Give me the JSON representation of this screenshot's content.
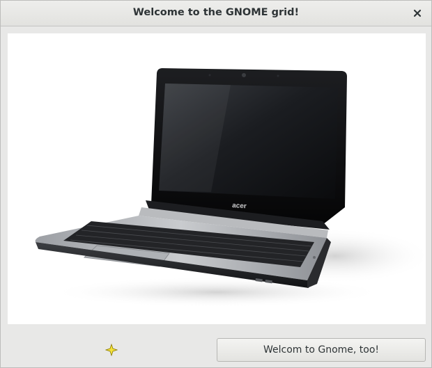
{
  "window": {
    "title": "Welcome to the GNOME grid!",
    "close_icon": "close-icon"
  },
  "image": {
    "description_icon": "laptop-image",
    "brand_mark": "acer"
  },
  "grid": {
    "sparkle_icon": "sparkle-icon",
    "button_label": "Welcom to Gnome, too!"
  },
  "colors": {
    "background": "#e8e8e7",
    "text": "#2e3436",
    "sparkle": "#f1d900"
  }
}
